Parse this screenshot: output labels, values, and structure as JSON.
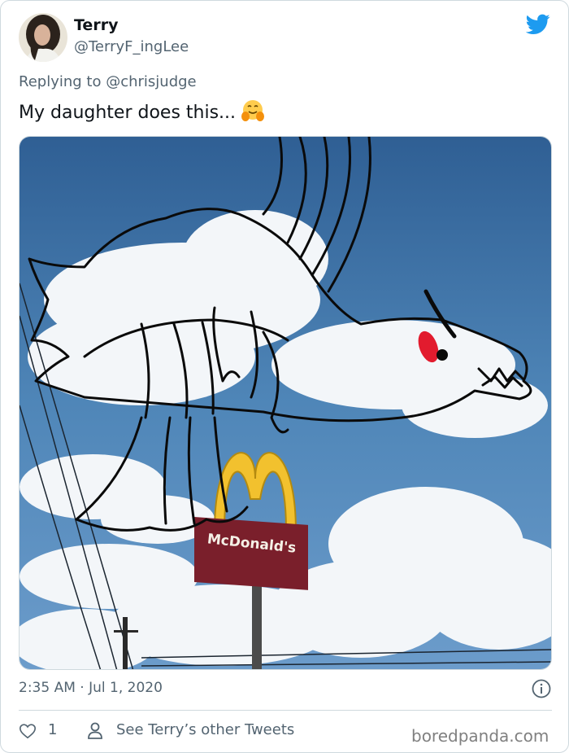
{
  "author": {
    "name": "Terry",
    "handle": "@TerryF_ingLee"
  },
  "reply": {
    "prefix": "Replying to ",
    "target": "@chrisjudge"
  },
  "tweet": {
    "text": "My daughter does this...",
    "emoji": "hugging-face-emoji"
  },
  "media": {
    "sign_text": "McDonald's"
  },
  "meta": {
    "timestamp": "2:35 AM · Jul 1, 2020"
  },
  "actions": {
    "like_count": "1",
    "see_other": "See Terry’s other Tweets"
  },
  "watermark": "boredpanda.com",
  "colors": {
    "twitter_blue": "#1d9bf0",
    "secondary_text": "#536471",
    "border": "#cfd9de"
  }
}
